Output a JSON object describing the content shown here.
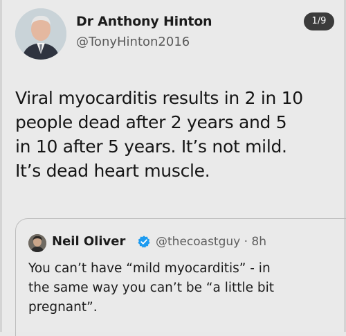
{
  "author": {
    "name": "Dr Anthony Hinton",
    "handle": "@TonyHinton2016",
    "avatar_icon": "person-photo-icon"
  },
  "thread_counter": "1/9",
  "tweet": {
    "lines": [
      "Viral myocarditis results in 2 in 10",
      "people dead after 2 years and 5",
      "in 10 after 5 years. It’s not mild.",
      "It’s dead heart muscle."
    ]
  },
  "quoted_tweet": {
    "name": "Neil Oliver",
    "handle_time": "@thecoastguy · 8h",
    "verified_icon": "verified-badge-icon",
    "lines": [
      "You can’t have “mild myocarditis” - in",
      "the same way you can’t be “a little bit",
      "pregnant”."
    ]
  },
  "colors": {
    "background": "#eaeaea",
    "badge": "#3b3b3b",
    "verified": "#1d9bf0"
  }
}
